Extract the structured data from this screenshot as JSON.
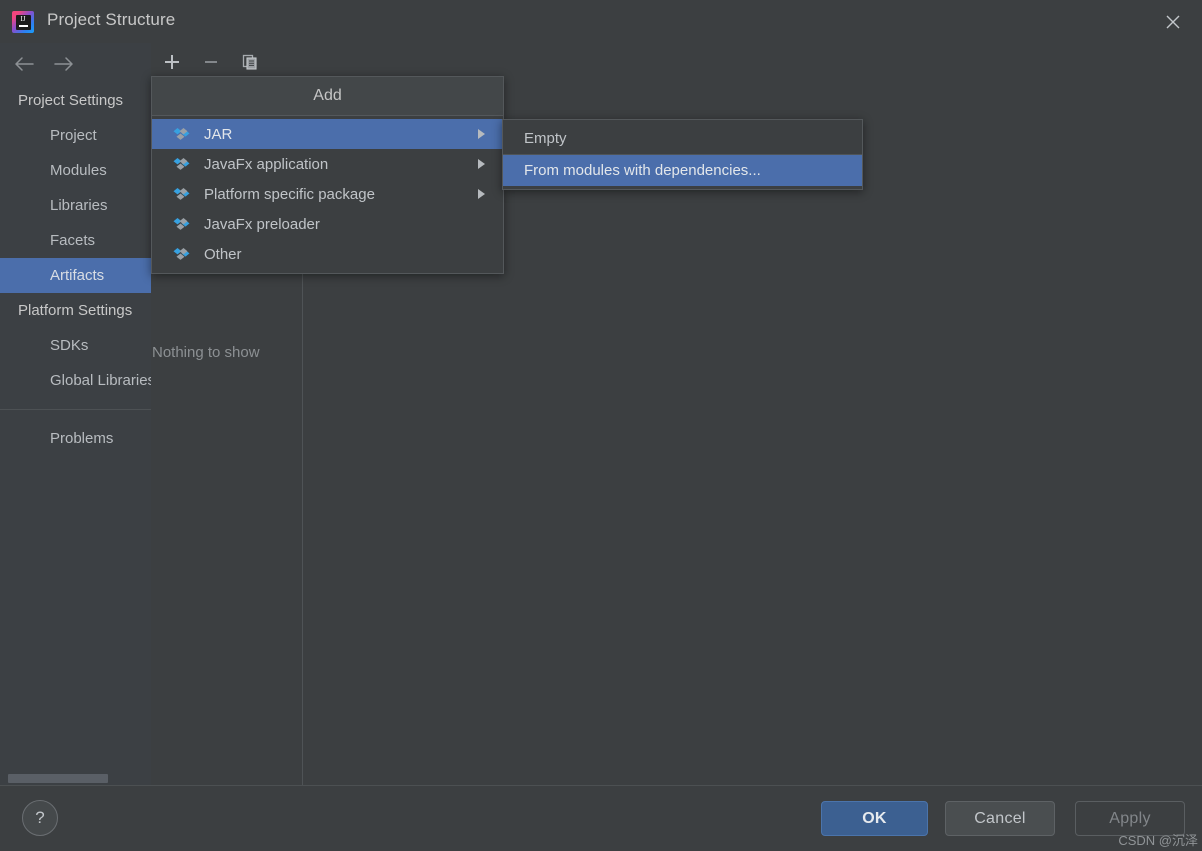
{
  "window": {
    "title": "Project Structure",
    "app_icon_text": "IJ",
    "close_label": "×"
  },
  "sidebar": {
    "back_label": "←",
    "forward_label": "→",
    "groups": [
      {
        "title": "Project Settings",
        "items": [
          {
            "label": "Project",
            "selected": false
          },
          {
            "label": "Modules",
            "selected": false
          },
          {
            "label": "Libraries",
            "selected": false
          },
          {
            "label": "Facets",
            "selected": false
          },
          {
            "label": "Artifacts",
            "selected": true
          }
        ]
      },
      {
        "title": "Platform Settings",
        "items": [
          {
            "label": "SDKs",
            "selected": false
          },
          {
            "label": "Global Libraries",
            "selected": false
          }
        ]
      }
    ],
    "extra_item": "Problems"
  },
  "toolbar": {
    "add_label": "+",
    "remove_label": "−",
    "copy_label": "copy-icon"
  },
  "left_pane": {
    "empty_message": "Nothing to show"
  },
  "add_menu": {
    "title": "Add",
    "items": [
      {
        "label": "JAR",
        "has_submenu": true,
        "highlighted": true
      },
      {
        "label": "JavaFx application",
        "has_submenu": true,
        "highlighted": false
      },
      {
        "label": "Platform specific package",
        "has_submenu": true,
        "highlighted": false
      },
      {
        "label": "JavaFx preloader",
        "has_submenu": false,
        "highlighted": false
      },
      {
        "label": "Other",
        "has_submenu": false,
        "highlighted": false
      }
    ]
  },
  "jar_submenu": {
    "items": [
      {
        "label": "Empty",
        "highlighted": false
      },
      {
        "label": "From modules with dependencies...",
        "highlighted": true
      }
    ]
  },
  "footer": {
    "help_label": "?",
    "ok_label": "OK",
    "cancel_label": "Cancel",
    "apply_label": "Apply"
  },
  "watermark": {
    "text": "CSDN @沉泽"
  },
  "colors": {
    "dialog_bg": "#3c3f41",
    "sidebar_bg": "#3c4044",
    "selection_blue": "#4b6eab",
    "ok_button_blue": "#3c6091",
    "icon_blue": "#37a1e0",
    "icon_gray": "#9aa0a6",
    "text_primary": "#c0c4c8",
    "text_muted": "#8c9093"
  }
}
